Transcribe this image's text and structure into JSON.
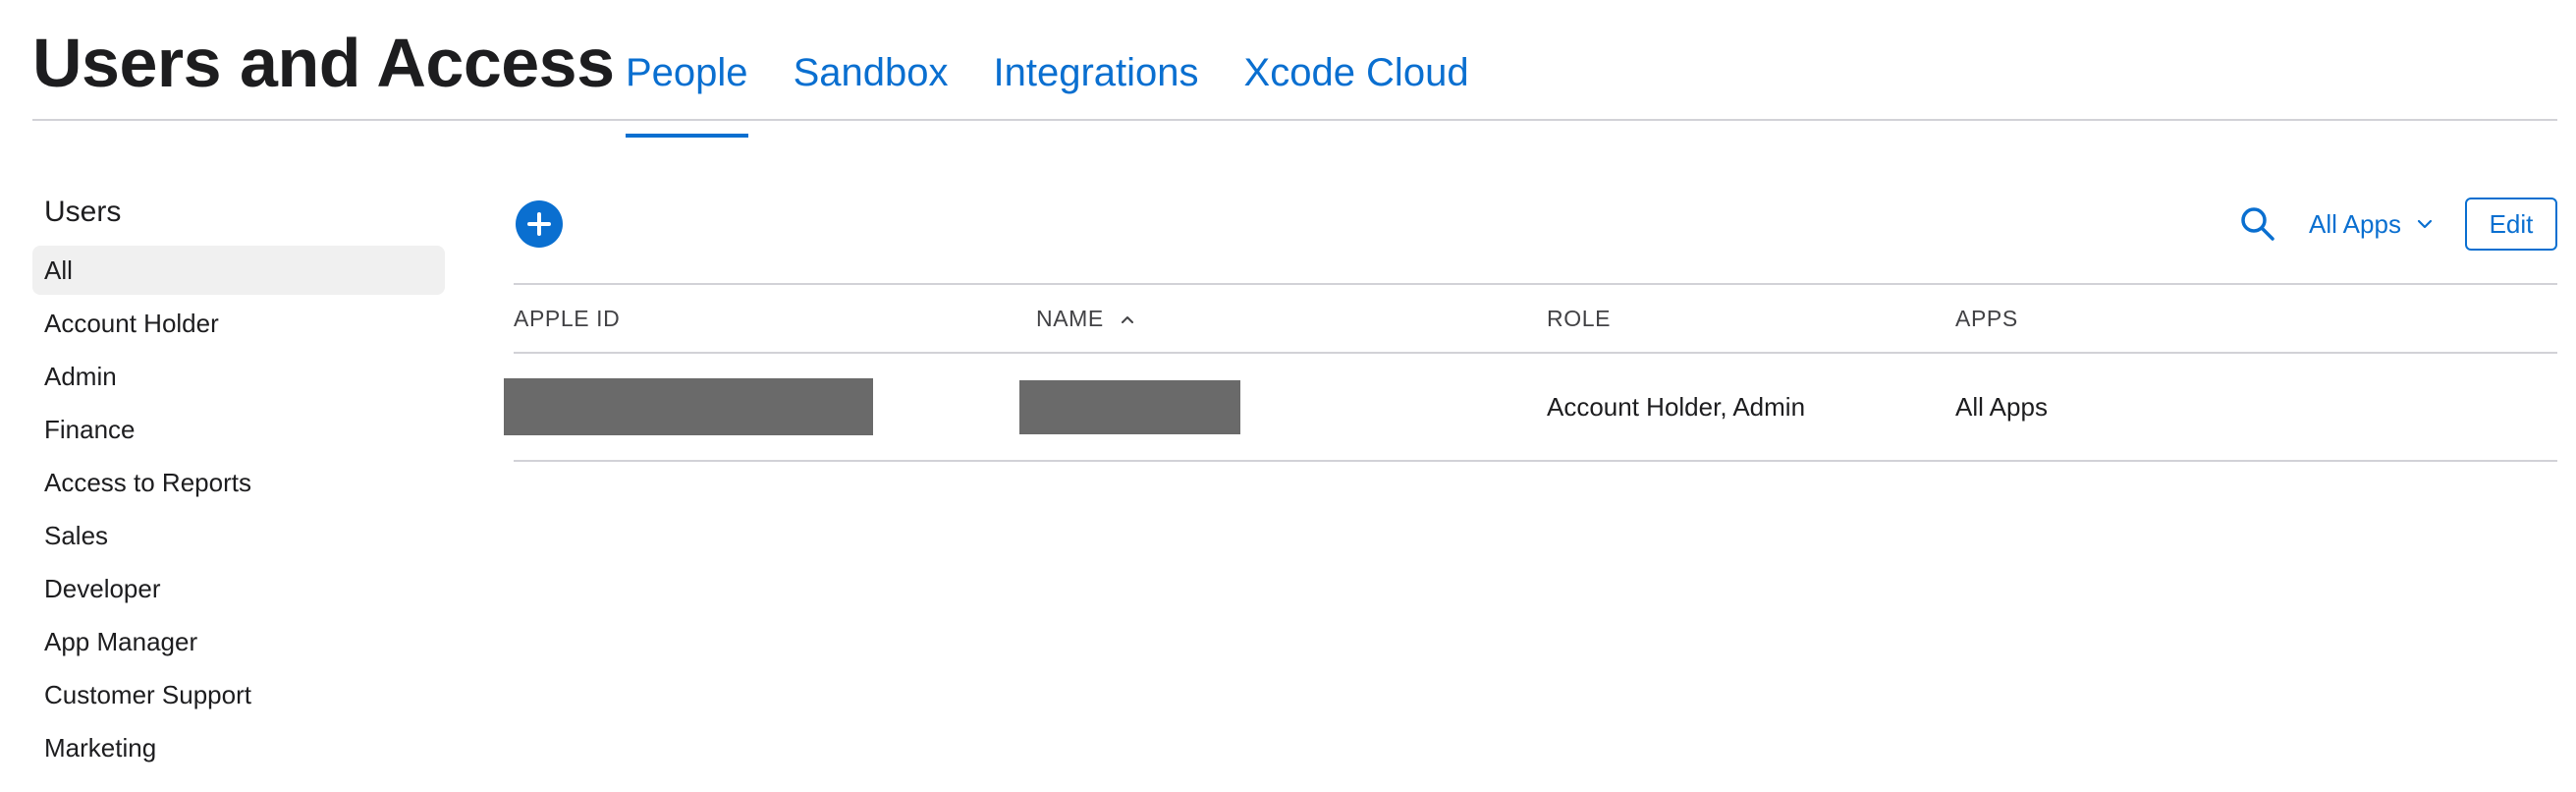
{
  "header": {
    "title": "Users and Access",
    "tabs": [
      {
        "label": "People",
        "active": true
      },
      {
        "label": "Sandbox",
        "active": false
      },
      {
        "label": "Integrations",
        "active": false
      },
      {
        "label": "Xcode Cloud",
        "active": false
      }
    ]
  },
  "sidebar": {
    "heading": "Users",
    "selected": "All",
    "items": [
      {
        "label": "All"
      },
      {
        "label": "Account Holder"
      },
      {
        "label": "Admin"
      },
      {
        "label": "Finance"
      },
      {
        "label": "Access to Reports"
      },
      {
        "label": "Sales"
      },
      {
        "label": "Developer"
      },
      {
        "label": "App Manager"
      },
      {
        "label": "Customer Support"
      },
      {
        "label": "Marketing"
      }
    ]
  },
  "toolbar": {
    "add_icon": "plus-circle-icon",
    "search_icon": "search-icon",
    "filter_label": "All Apps",
    "filter_icon": "chevron-down-icon",
    "edit_label": "Edit"
  },
  "table": {
    "columns": [
      {
        "label": "APPLE ID"
      },
      {
        "label": "NAME",
        "sort": "ascending",
        "sort_icon": "chevron-up-icon"
      },
      {
        "label": "ROLE"
      },
      {
        "label": "APPS"
      }
    ],
    "rows": [
      {
        "apple_id": "",
        "apple_id_redacted": true,
        "name": "",
        "name_redacted": true,
        "role": "Account Holder, Admin",
        "apps": "All Apps"
      }
    ]
  },
  "colors": {
    "accent": "#0a6fd0",
    "text": "#1d1d1f",
    "divider": "#d2d2d7",
    "selected_background": "#f0f0f0",
    "redaction": "#6a6a6a"
  }
}
